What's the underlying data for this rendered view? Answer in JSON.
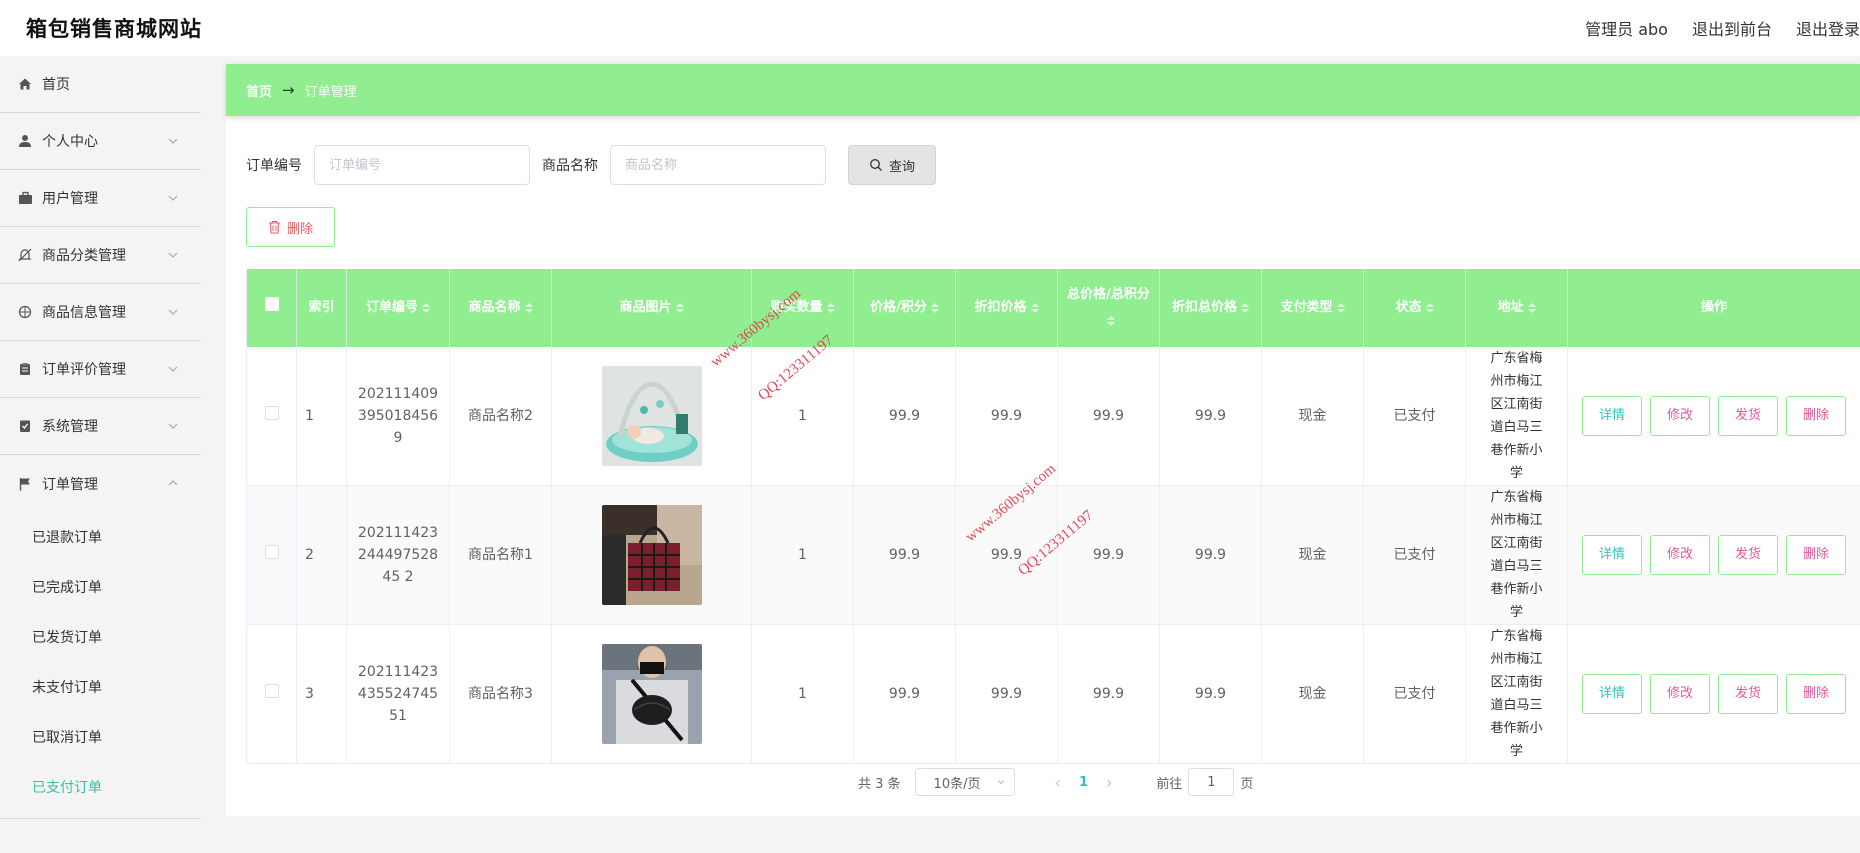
{
  "header": {
    "title": "箱包销售商城网站",
    "admin_label": "管理员 abo",
    "to_front": "退出到前台",
    "logout": "退出登录"
  },
  "sidebar": {
    "items": [
      {
        "label": "首页",
        "icon": "home-icon",
        "expandable": false
      },
      {
        "label": "个人中心",
        "icon": "user-icon",
        "expandable": true
      },
      {
        "label": "用户管理",
        "icon": "briefcase-icon",
        "expandable": true
      },
      {
        "label": "商品分类管理",
        "icon": "bell-off-icon",
        "expandable": true
      },
      {
        "label": "商品信息管理",
        "icon": "compass-icon",
        "expandable": true
      },
      {
        "label": "订单评价管理",
        "icon": "clipboard-icon",
        "expandable": true
      },
      {
        "label": "系统管理",
        "icon": "document-icon",
        "expandable": true
      },
      {
        "label": "订单管理",
        "icon": "flag-icon",
        "expandable": true
      }
    ],
    "sub_items": [
      "已退款订单",
      "已完成订单",
      "已发货订单",
      "未支付订单",
      "已取消订单",
      "已支付订单"
    ],
    "active_sub": "已支付订单",
    "accent_color": "#36c2a0"
  },
  "breadcrumb": {
    "home": "首页",
    "separator": "→",
    "current": "订单管理"
  },
  "search": {
    "order_label": "订单编号",
    "order_placeholder": "订单编号",
    "order_value": "",
    "product_label": "商品名称",
    "product_placeholder": "商品名称",
    "product_value": "",
    "query_button": "查询"
  },
  "delete_button": "删除",
  "table": {
    "header_color": "#90ee90",
    "columns": [
      "索引",
      "订单编号",
      "商品名称",
      "商品图片",
      "购买数量",
      "价格/积分",
      "折扣价格",
      "总价格/总积分",
      "折扣总价格",
      "支付类型",
      "状态",
      "地址",
      "操作"
    ],
    "rows": [
      {
        "index": "1",
        "order_no": "2021114093950184569",
        "product": "商品名称2",
        "image": "baby-playmat-image",
        "qty": "1",
        "price": "99.9",
        "discount": "99.9",
        "total": "99.9",
        "discount_total": "99.9",
        "pay_type": "现金",
        "status": "已支付",
        "address": "广东省梅州市梅江区江南街道白马三巷作新小学"
      },
      {
        "index": "2",
        "order_no": "20211142324449752845 2",
        "product": "商品名称1",
        "image": "plaid-tote-bag-image",
        "qty": "1",
        "price": "99.9",
        "discount": "99.9",
        "total": "99.9",
        "discount_total": "99.9",
        "pay_type": "现金",
        "status": "已支付",
        "address": "广东省梅州市梅江区江南街道白马三巷作新小学"
      },
      {
        "index": "3",
        "order_no": "20211142343552474551",
        "product": "商品名称3",
        "image": "chest-bag-image",
        "qty": "1",
        "price": "99.9",
        "discount": "99.9",
        "total": "99.9",
        "discount_total": "99.9",
        "pay_type": "现金",
        "status": "已支付",
        "address": "广东省梅州市梅江区江南街道白马三巷作新小学"
      }
    ],
    "actions": {
      "detail": "详情",
      "edit": "修改",
      "ship": "发货",
      "delete": "删除"
    }
  },
  "pagination": {
    "total": "共 3 条",
    "page_size": "10条/页",
    "current_page": "1",
    "goto_label": "前往",
    "goto_value": "1",
    "page_suffix": "页"
  },
  "watermark": {
    "site": "www.360bysj.com",
    "qq": "QQ:123311197"
  }
}
